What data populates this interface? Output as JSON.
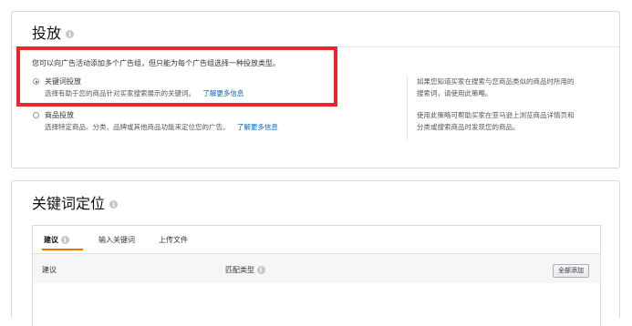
{
  "targeting_type": {
    "title": "投放",
    "description": "您可以向广告活动添加多个广告组，但只能为每个广告组选择一种投放类型。",
    "options": [
      {
        "label": "关键词投放",
        "desc": "选择有助于您的商品针对买家搜索展示的关键词。",
        "link": "了解更多信息",
        "selected": true,
        "help_line1": "如果您知道买家在搜索与您商品类似的商品时所用的",
        "help_line2": "搜索词，请使用此策略。"
      },
      {
        "label": "商品投放",
        "desc": "选择特定商品、分类、品牌或其他商品功能来定位您的广告。",
        "link": "了解更多信息",
        "selected": false,
        "help_line1": "使用此策略可帮助买家在亚马逊上浏览商品详情页和",
        "help_line2": "分类或搜索商品时发现您的商品。"
      }
    ]
  },
  "keyword_targeting": {
    "title": "关键词定位",
    "tabs": [
      {
        "label": "建议",
        "active": true
      },
      {
        "label": "输入关键词",
        "active": false
      },
      {
        "label": "上传文件",
        "active": false
      }
    ],
    "table": {
      "col_suggestion": "建议",
      "col_match_type": "匹配类型",
      "add_all_button": "全部添加"
    }
  },
  "colors": {
    "highlight_box": "#e8282c",
    "link": "#0066c0",
    "tab_underline": "#e77600"
  }
}
